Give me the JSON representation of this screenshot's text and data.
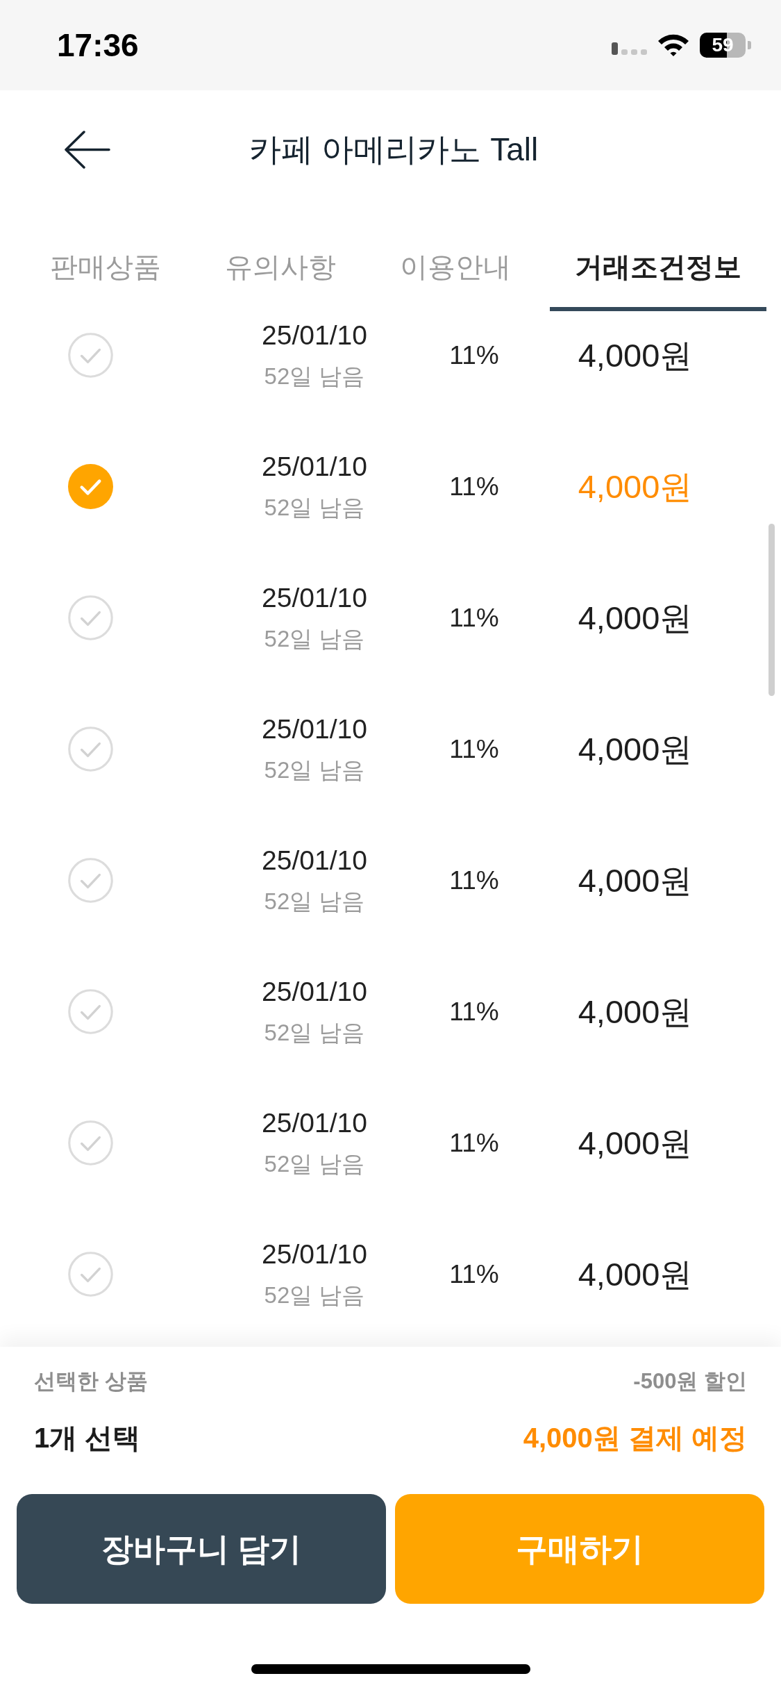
{
  "status_bar": {
    "time": "17:36",
    "battery": "59"
  },
  "header": {
    "title": "카페 아메리카노 Tall"
  },
  "tabs": [
    {
      "label": "판매상품",
      "selected": false
    },
    {
      "label": "유의사항",
      "selected": false
    },
    {
      "label": "이용안내",
      "selected": false
    },
    {
      "label": "거래조건정보",
      "selected": true
    }
  ],
  "offers": [
    {
      "date": "25/01/10",
      "remaining": "52일 남음",
      "rate": "11%",
      "price": "4,000원",
      "selected": false
    },
    {
      "date": "25/01/10",
      "remaining": "52일 남음",
      "rate": "11%",
      "price": "4,000원",
      "selected": true
    },
    {
      "date": "25/01/10",
      "remaining": "52일 남음",
      "rate": "11%",
      "price": "4,000원",
      "selected": false
    },
    {
      "date": "25/01/10",
      "remaining": "52일 남음",
      "rate": "11%",
      "price": "4,000원",
      "selected": false
    },
    {
      "date": "25/01/10",
      "remaining": "52일 남음",
      "rate": "11%",
      "price": "4,000원",
      "selected": false
    },
    {
      "date": "25/01/10",
      "remaining": "52일 남음",
      "rate": "11%",
      "price": "4,000원",
      "selected": false
    },
    {
      "date": "25/01/10",
      "remaining": "52일 남음",
      "rate": "11%",
      "price": "4,000원",
      "selected": false
    },
    {
      "date": "25/01/10",
      "remaining": "52일 남음",
      "rate": "11%",
      "price": "4,000원",
      "selected": false
    }
  ],
  "summary": {
    "label": "선택한 상품",
    "discount": "-500원 할인",
    "count": "1개 선택",
    "total": "4,000원 결제 예정"
  },
  "buttons": [
    {
      "label": "장바구니 담기",
      "kind": "secondary"
    },
    {
      "label": "구매하기",
      "kind": "primary"
    }
  ]
}
